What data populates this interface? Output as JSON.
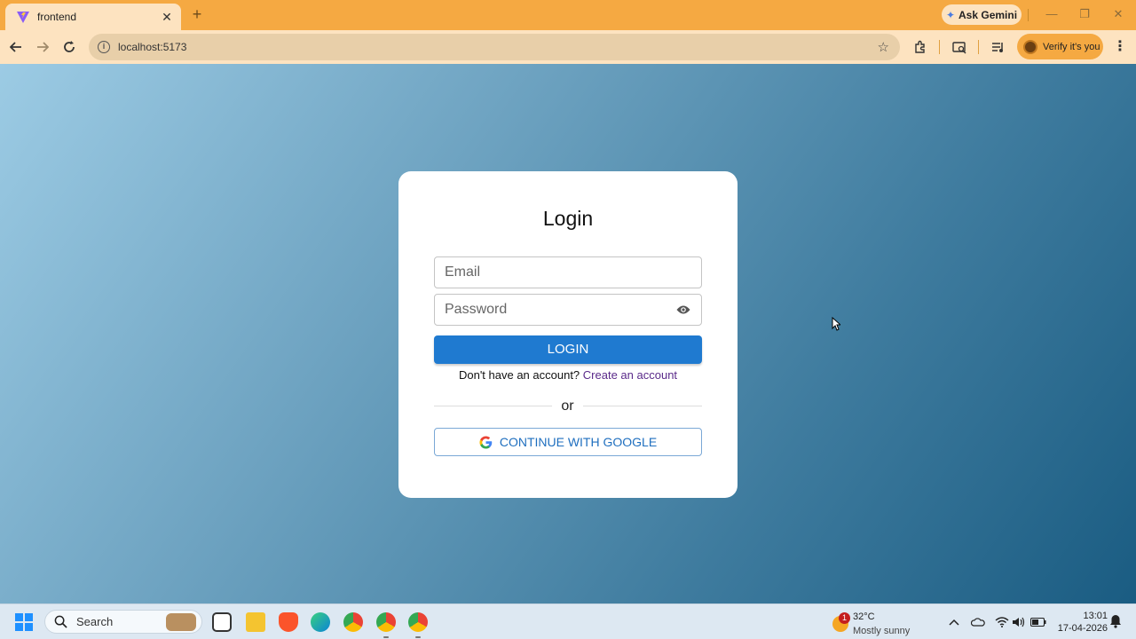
{
  "browser": {
    "tab_title": "frontend",
    "new_tab_symbol": "+",
    "gemini_label": "Ask Gemini",
    "url": "localhost:5173",
    "profile_label": "Verify it's you"
  },
  "login": {
    "title": "Login",
    "email_placeholder": "Email",
    "password_placeholder": "Password",
    "login_button": "LOGIN",
    "no_account_text": "Don't have an account?",
    "create_account_link": "Create an account",
    "divider_text": "or",
    "google_button": "CONTINUE WITH GOOGLE"
  },
  "colors": {
    "primary": "#1f7ad0",
    "link": "#5a2a8a",
    "tab_bar": "#f5a942",
    "toolbar": "#fde3c0"
  },
  "taskbar": {
    "search_label": "Search",
    "weather_temp": "32°C",
    "weather_desc": "Mostly sunny",
    "weather_badge": "1",
    "time": "13:01",
    "date": "17-04-2026",
    "apps": [
      "task-view-icon",
      "file-explorer-icon",
      "brave-icon",
      "edge-icon",
      "chrome-icon",
      "chrome-profile-a-icon",
      "chrome-profile-b-icon"
    ]
  }
}
